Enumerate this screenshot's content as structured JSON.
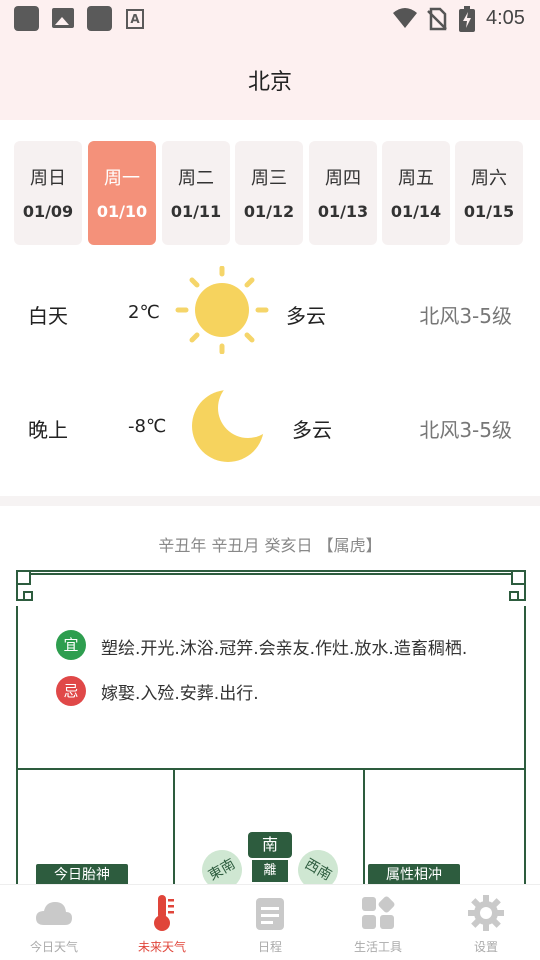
{
  "status_bar": {
    "time": "4:05",
    "icons": [
      "square-notification-icon",
      "image-icon",
      "square-notification-icon",
      "text-a-icon",
      "wifi-icon",
      "no-sim-icon",
      "battery-charging-icon"
    ]
  },
  "header": {
    "city": "北京"
  },
  "days": [
    {
      "weekday": "周日",
      "date": "01/09"
    },
    {
      "weekday": "周一",
      "date": "01/10",
      "selected": true
    },
    {
      "weekday": "周二",
      "date": "01/11"
    },
    {
      "weekday": "周三",
      "date": "01/12"
    },
    {
      "weekday": "周四",
      "date": "01/13"
    },
    {
      "weekday": "周五",
      "date": "01/14"
    },
    {
      "weekday": "周六",
      "date": "01/15"
    }
  ],
  "day_weather": {
    "label": "白天",
    "temp": "2℃",
    "icon": "sun-icon",
    "condition": "多云",
    "wind": "北风3-5级"
  },
  "night_weather": {
    "label": "晚上",
    "temp": "-8℃",
    "icon": "moon-icon",
    "condition": "多云",
    "wind": "北风3-5级"
  },
  "almanac": {
    "ganzhi": "辛丑年 辛丑月 癸亥日 【属虎】",
    "yi_badge": "宜",
    "yi_text": "塑绘.开光.沐浴.冠笄.会亲友.作灶.放水.造畜稠栖.",
    "ji_badge": "忌",
    "ji_text": "嫁娶.入殓.安葬.出行.",
    "tag_left": "今日胎神",
    "tag_right": "属性相冲",
    "compass": {
      "south": "南",
      "southeast": "東南",
      "southwest": "西南",
      "li": "離"
    }
  },
  "colors": {
    "accent": "#f4917a",
    "panel_green": "#2d5c3e",
    "yi_green": "#2e9e4f",
    "ji_red": "#e04848",
    "tab_active": "#e0453a"
  },
  "tabbar": [
    {
      "label": "今日天气",
      "icon": "cloud-icon"
    },
    {
      "label": "未来天气",
      "icon": "thermometer-icon",
      "active": true
    },
    {
      "label": "日程",
      "icon": "calendar-icon"
    },
    {
      "label": "生活工具",
      "icon": "tools-grid-icon"
    },
    {
      "label": "设置",
      "icon": "gear-icon"
    }
  ]
}
